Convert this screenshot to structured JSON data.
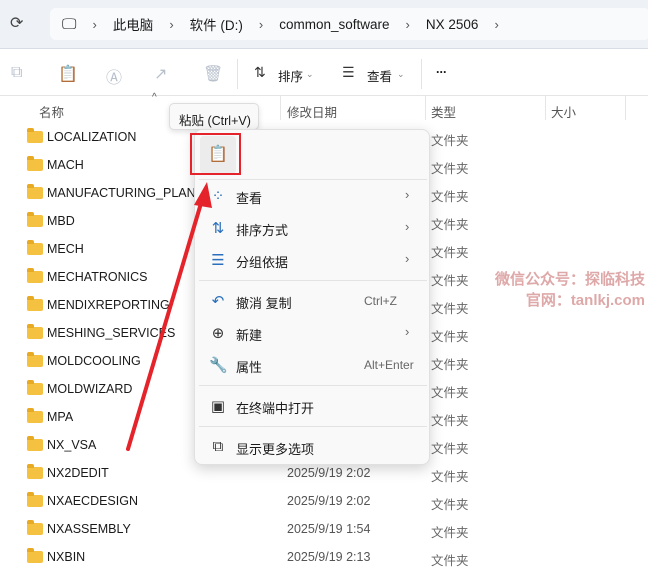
{
  "breadcrumb": [
    "此电脑",
    "软件 (D:)",
    "common_software",
    "NX 2506"
  ],
  "toolbar": {
    "sort": "排序",
    "view": "查看",
    "more": "..."
  },
  "columns": {
    "name": "名称",
    "date": "修改日期",
    "type": "类型",
    "size": "大小"
  },
  "rows": [
    {
      "name": "LOCALIZATION",
      "date": "",
      "type": "文件夹"
    },
    {
      "name": "MACH",
      "date": "",
      "type": "文件夹"
    },
    {
      "name": "MANUFACTURING_PLANNING",
      "date": "",
      "type": "文件夹"
    },
    {
      "name": "MBD",
      "date": "",
      "type": "文件夹"
    },
    {
      "name": "MECH",
      "date": "",
      "type": "文件夹"
    },
    {
      "name": "MECHATRONICS",
      "date": "",
      "type": "文件夹"
    },
    {
      "name": "MENDIXREPORTING",
      "date": "",
      "type": "文件夹"
    },
    {
      "name": "MESHING_SERVICES",
      "date": "",
      "type": "文件夹"
    },
    {
      "name": "MOLDCOOLING",
      "date": "",
      "type": "文件夹"
    },
    {
      "name": "MOLDWIZARD",
      "date": "",
      "type": "文件夹"
    },
    {
      "name": "MPA",
      "date": "",
      "type": "文件夹"
    },
    {
      "name": "NX_VSA",
      "date": "",
      "type": "文件夹"
    },
    {
      "name": "NX2DEDIT",
      "date": "2025/9/19 2:02",
      "type": "文件夹"
    },
    {
      "name": "NXAECDESIGN",
      "date": "2025/9/19 2:02",
      "type": "文件夹"
    },
    {
      "name": "NXASSEMBLY",
      "date": "2025/9/19 1:54",
      "type": "文件夹"
    },
    {
      "name": "NXBIN",
      "date": "2025/9/19 2:13",
      "type": "文件夹"
    }
  ],
  "tooltip": "粘贴 (Ctrl+V)",
  "menu": {
    "view": "查看",
    "sort": "排序方式",
    "group": "分组依据",
    "undo": "撤消 复制",
    "undo_shortcut": "Ctrl+Z",
    "new": "新建",
    "properties": "属性",
    "properties_shortcut": "Alt+Enter",
    "terminal": "在终端中打开",
    "more": "显示更多选项"
  },
  "watermark": {
    "line1": "微信公众号：探临科技",
    "line2": "官网：tanlkj.com"
  }
}
